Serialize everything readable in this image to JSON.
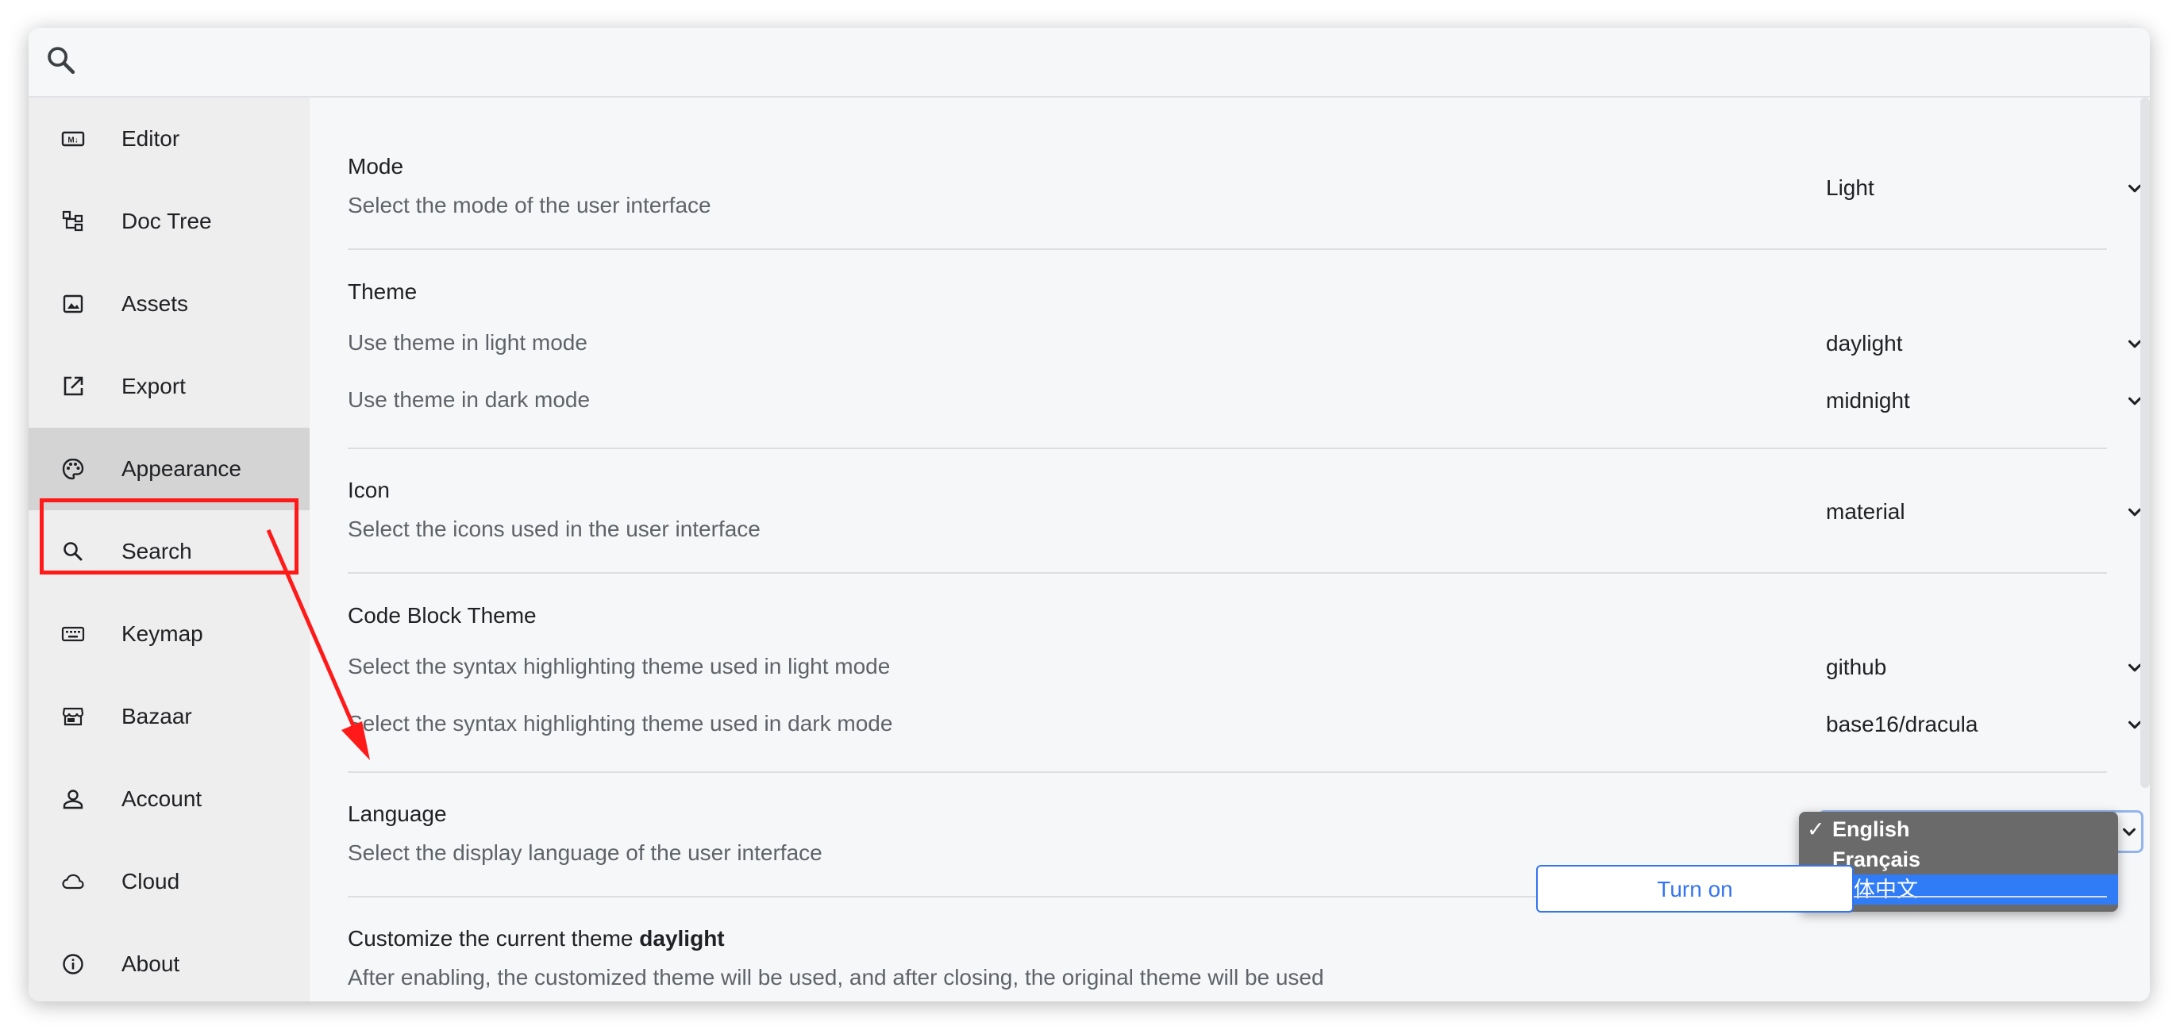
{
  "search": {
    "icon": "search-icon"
  },
  "sidebar": {
    "items": [
      {
        "label": "Editor",
        "icon": "markdown-icon"
      },
      {
        "label": "Doc Tree",
        "icon": "tree-icon"
      },
      {
        "label": "Assets",
        "icon": "image-icon"
      },
      {
        "label": "Export",
        "icon": "export-icon"
      },
      {
        "label": "Appearance",
        "icon": "palette-icon",
        "active": true
      },
      {
        "label": "Search",
        "icon": "search-icon"
      },
      {
        "label": "Keymap",
        "icon": "keyboard-icon"
      },
      {
        "label": "Bazaar",
        "icon": "store-icon"
      },
      {
        "label": "Account",
        "icon": "person-icon"
      },
      {
        "label": "Cloud",
        "icon": "cloud-icon"
      },
      {
        "label": "About",
        "icon": "info-icon"
      }
    ]
  },
  "settings": {
    "mode": {
      "title": "Mode",
      "desc": "Select the mode of the user interface",
      "value": "Light"
    },
    "theme": {
      "title": "Theme",
      "light_desc": "Use theme in light mode",
      "light_value": "daylight",
      "dark_desc": "Use theme in dark mode",
      "dark_value": "midnight"
    },
    "icon": {
      "title": "Icon",
      "desc": "Select the icons used in the user interface",
      "value": "material"
    },
    "code_block_theme": {
      "title": "Code Block Theme",
      "light_desc": "Select the syntax highlighting theme used in light mode",
      "light_value": "github",
      "dark_desc": "Select the syntax highlighting theme used in dark mode",
      "dark_value": "base16/dracula"
    },
    "language": {
      "title": "Language",
      "desc": "Select the display language of the user interface",
      "options": [
        {
          "label": "English",
          "checked": true
        },
        {
          "label": "Français",
          "checked": false
        },
        {
          "label": "简体中文",
          "highlighted": true
        }
      ],
      "check_mark": "✓"
    },
    "customize": {
      "title_prefix": "Customize the current theme ",
      "title_theme": "daylight",
      "desc": "After enabling, the customized theme will be used, and after closing, the original theme will be used",
      "button": "Turn on"
    }
  },
  "colors": {
    "accent": "#3574f0",
    "annotation": "#ff1a1a",
    "dropdown_highlight": "#2f7cf6"
  }
}
